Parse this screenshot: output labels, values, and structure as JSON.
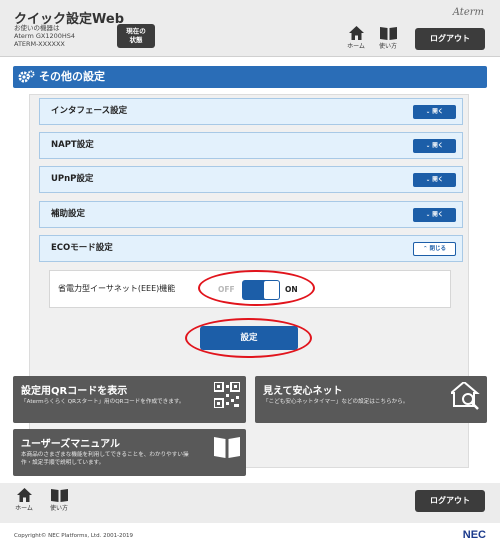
{
  "header": {
    "app_title": "クイック設定Web",
    "device_label": "お使いの機器は",
    "device_model": "Aterm GX1200HS4",
    "device_name": "ATERM-XXXXXX",
    "status_button_line1": "現在の",
    "status_button_line2": "状態",
    "brand": "Aterm",
    "home_label": "ホーム",
    "manual_label": "使い方",
    "logout_label": "ログアウト"
  },
  "section": {
    "title": "その他の設定"
  },
  "settings": {
    "rows": [
      {
        "label": "インタフェース設定",
        "button": "開く"
      },
      {
        "label": "NAPT設定",
        "button": "開く"
      },
      {
        "label": "UPnP設定",
        "button": "開く"
      },
      {
        "label": "補助設定",
        "button": "開く"
      },
      {
        "label": "ECOモード設定",
        "button": "閉じる"
      }
    ],
    "eee": {
      "label": "省電力型イーサネット(EEE)機能",
      "off_label": "OFF",
      "on_label": "ON",
      "state": "on"
    },
    "apply_label": "設定"
  },
  "cards": {
    "qr": {
      "title": "設定用QRコードを表示",
      "desc": "「Atermらくらく QRスタート」用のQRコードを作成できます。"
    },
    "safety": {
      "title": "見えて安心ネット",
      "desc": "「こども安心ネットタイマー」などの設定はこちらから。"
    },
    "manual": {
      "title": "ユーザーズマニュアル",
      "desc1": "本商品のさまざまな機能を利用してできることを、わかりやすい操",
      "desc2": "作・設定手順で説明しています。"
    }
  },
  "footer": {
    "home_label": "ホーム",
    "manual_label": "使い方",
    "logout_label": "ログアウト",
    "copyright": "Copyright© NEC Platforms, Ltd. 2001-2019",
    "nec": "NEC"
  },
  "colors": {
    "accent_blue": "#1c5ea8",
    "section_blue": "#2a6db7",
    "row_bg": "#e3f1fc",
    "highlight_red": "#e1141c",
    "card_gray": "#595959"
  }
}
